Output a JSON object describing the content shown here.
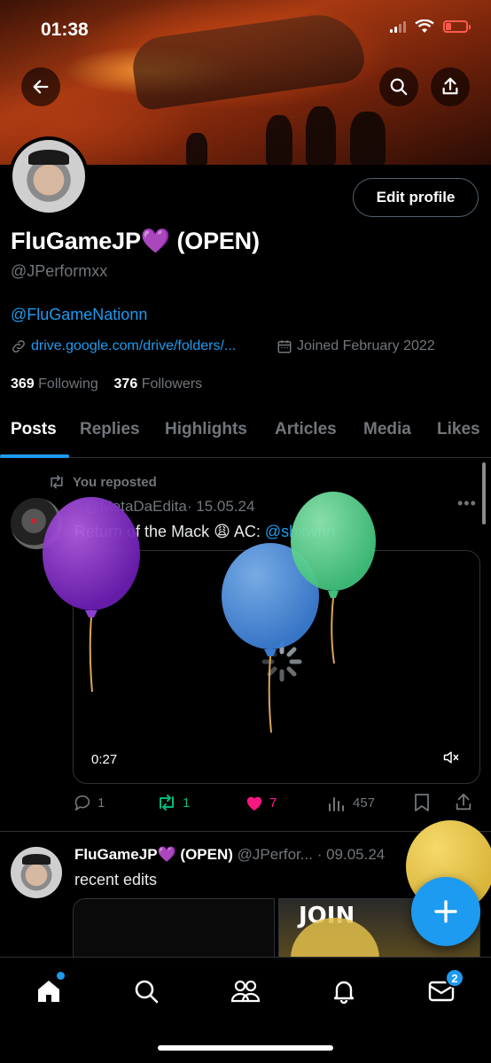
{
  "status_bar": {
    "time": "01:38"
  },
  "profile": {
    "display_name": "FluGameJP💜 (OPEN)",
    "handle": "@JPerformxx",
    "bio_mention": "@FluGameNationn",
    "link": "drive.google.com/drive/folders/...",
    "joined": "Joined February 2022",
    "following_count": "369",
    "following_label": "Following",
    "followers_count": "376",
    "followers_label": "Followers",
    "edit_profile_label": "Edit profile"
  },
  "tabs": [
    {
      "label": "Posts",
      "active": true
    },
    {
      "label": "Replies"
    },
    {
      "label": "Highlights"
    },
    {
      "label": "Articles"
    },
    {
      "label": "Media"
    },
    {
      "label": "Likes"
    }
  ],
  "posts": [
    {
      "repost_label": "You reposted",
      "author_prefix": "*",
      "handle": "@MetaDaEdita",
      "date": "· 15.05.24",
      "text_main": "Return of the Mack 😩 AC: ",
      "text_mention": "@shxwnn",
      "video_time": "0:27",
      "replies": "1",
      "reposts": "1",
      "likes": "7",
      "views": "457"
    },
    {
      "author_name": "FluGameJP💜 (OPEN)",
      "handle": "@JPerfor...",
      "date": "· 09.05.24",
      "text": "recent edits",
      "thumb_text": "JOIN"
    }
  ],
  "nav": {
    "messages_badge": "2"
  },
  "colors": {
    "accent": "#1d9bf0",
    "like": "#f91880",
    "repost": "#00ba7c",
    "background": "#000000"
  },
  "icons": [
    "back-arrow-icon",
    "search-icon",
    "share-icon",
    "link-icon",
    "calendar-icon",
    "repost-icon",
    "reply-icon",
    "heart-icon",
    "views-icon",
    "bookmark-icon",
    "mute-icon",
    "plus-icon",
    "home-icon",
    "people-icon",
    "bell-icon",
    "mail-icon"
  ]
}
